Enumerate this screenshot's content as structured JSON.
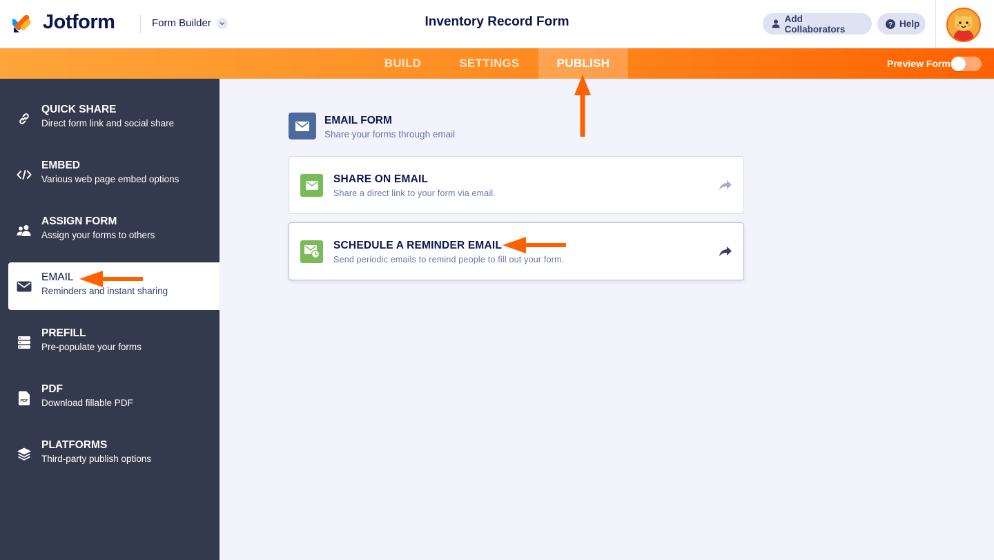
{
  "header": {
    "brand": "Jotform",
    "app_switcher": "Form Builder",
    "form_title": "Inventory Record Form",
    "add_collaborators": "Add Collaborators",
    "help": "Help"
  },
  "nav": {
    "tabs": [
      {
        "label": "BUILD",
        "active": false
      },
      {
        "label": "SETTINGS",
        "active": false
      },
      {
        "label": "PUBLISH",
        "active": true
      }
    ],
    "preview_label": "Preview Form",
    "preview_on": false
  },
  "sidebar": {
    "items": [
      {
        "title": "QUICK SHARE",
        "sub": "Direct form link and social share",
        "icon": "link-icon"
      },
      {
        "title": "EMBED",
        "sub": "Various web page embed options",
        "icon": "code-icon"
      },
      {
        "title": "ASSIGN FORM",
        "sub": "Assign your forms to others",
        "icon": "users-icon"
      },
      {
        "title": "EMAIL",
        "sub": "Reminders and instant sharing",
        "icon": "envelope-icon",
        "active": true
      },
      {
        "title": "PREFILL",
        "sub": "Pre-populate your forms",
        "icon": "database-icon"
      },
      {
        "title": "PDF",
        "sub": "Download fillable PDF",
        "icon": "pdf-icon"
      },
      {
        "title": "PLATFORMS",
        "sub": "Third-party publish options",
        "icon": "layers-icon"
      }
    ]
  },
  "main": {
    "section_title": "EMAIL FORM",
    "section_sub": "Share your forms through email",
    "cards": [
      {
        "title": "SHARE ON EMAIL",
        "sub": "Share a direct link to your form via email.",
        "icon": "envelope-icon"
      },
      {
        "title": "SCHEDULE A REMINDER EMAIL",
        "sub": "Send periodic emails to remind people to fill out your form.",
        "icon": "envelope-clock-icon"
      }
    ]
  },
  "colors": {
    "accent": "#ff6100",
    "sidebar_bg": "#343a4d",
    "navy": "#0a1551",
    "green": "#78bb57"
  }
}
